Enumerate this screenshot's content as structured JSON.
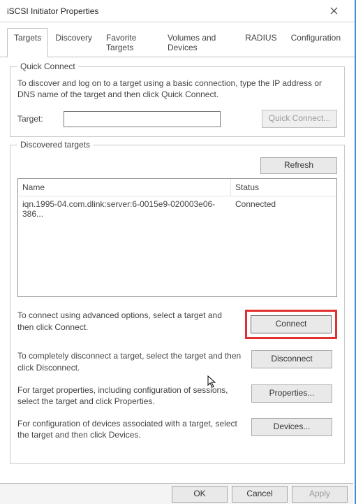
{
  "window": {
    "title": "iSCSI Initiator Properties"
  },
  "tabs": {
    "targets": "Targets",
    "discovery": "Discovery",
    "favorites": "Favorite Targets",
    "volumes": "Volumes and Devices",
    "radius": "RADIUS",
    "configuration": "Configuration"
  },
  "quick_connect": {
    "legend": "Quick Connect",
    "description": "To discover and log on to a target using a basic connection, type the IP address or DNS name of the target and then click Quick Connect.",
    "target_label": "Target:",
    "target_value": "",
    "button": "Quick Connect..."
  },
  "discovered": {
    "legend": "Discovered targets",
    "refresh": "Refresh",
    "columns": {
      "name": "Name",
      "status": "Status"
    },
    "rows": [
      {
        "name": "iqn.1995-04.com.dlink:server:6-0015e9-020003e06-386...",
        "status": "Connected"
      }
    ]
  },
  "instructions": {
    "connect_text": "To connect using advanced options, select a target and then click Connect.",
    "connect_btn": "Connect",
    "disconnect_text": "To completely disconnect a target, select the target and then click Disconnect.",
    "disconnect_btn": "Disconnect",
    "properties_text": "For target properties, including configuration of sessions, select the target and click Properties.",
    "properties_btn": "Properties...",
    "devices_text": "For configuration of devices associated with a target, select the target and then click Devices.",
    "devices_btn": "Devices..."
  },
  "footer": {
    "ok": "OK",
    "cancel": "Cancel",
    "apply": "Apply"
  }
}
